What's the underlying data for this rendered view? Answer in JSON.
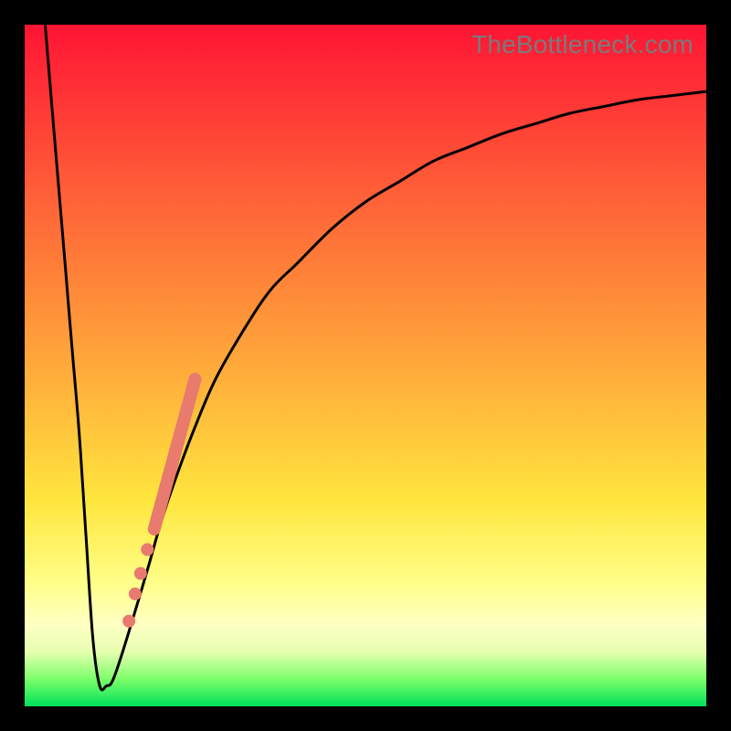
{
  "watermark": "TheBottleneck.com",
  "colors": {
    "frame": "#000000",
    "curve": "#000000",
    "markers": "#e87a6e",
    "gradient_top": "#ff1434",
    "gradient_bottom": "#00e05a"
  },
  "chart_data": {
    "type": "line",
    "title": "",
    "xlabel": "",
    "ylabel": "",
    "xlim": [
      0,
      100
    ],
    "ylim": [
      0,
      100
    ],
    "notes": "Bottleneck-percentage style curve. Y ≈ 0 is best (green); Y ≈ 100 is worst (red). Minimum (valley) sits near x≈10 at y≈3. Left branch descends steeply from (3,100) to the valley; right branch rises from the valley and asymptotes toward y≈90 at x=100.",
    "series": [
      {
        "name": "bottleneck-curve",
        "x": [
          3,
          4,
          5,
          6,
          7,
          8,
          9,
          10,
          11,
          12,
          13,
          15,
          18,
          20,
          22,
          25,
          28,
          32,
          36,
          40,
          45,
          50,
          55,
          60,
          65,
          70,
          75,
          80,
          85,
          90,
          95,
          100
        ],
        "y": [
          100,
          88,
          76,
          64,
          52,
          40,
          25,
          10,
          3,
          3,
          4,
          10,
          20,
          27,
          33,
          41,
          48,
          55,
          61,
          65,
          70,
          74,
          77,
          80,
          82,
          84,
          85.5,
          87,
          88,
          89,
          89.6,
          90.2
        ]
      }
    ],
    "markers": {
      "segment": {
        "x1": 19,
        "y1": 26,
        "x2": 25,
        "y2": 48
      },
      "dots": [
        {
          "x": 18.0,
          "y": 23.0
        },
        {
          "x": 17.0,
          "y": 19.5
        },
        {
          "x": 16.2,
          "y": 16.5
        },
        {
          "x": 15.3,
          "y": 12.5
        }
      ]
    }
  }
}
